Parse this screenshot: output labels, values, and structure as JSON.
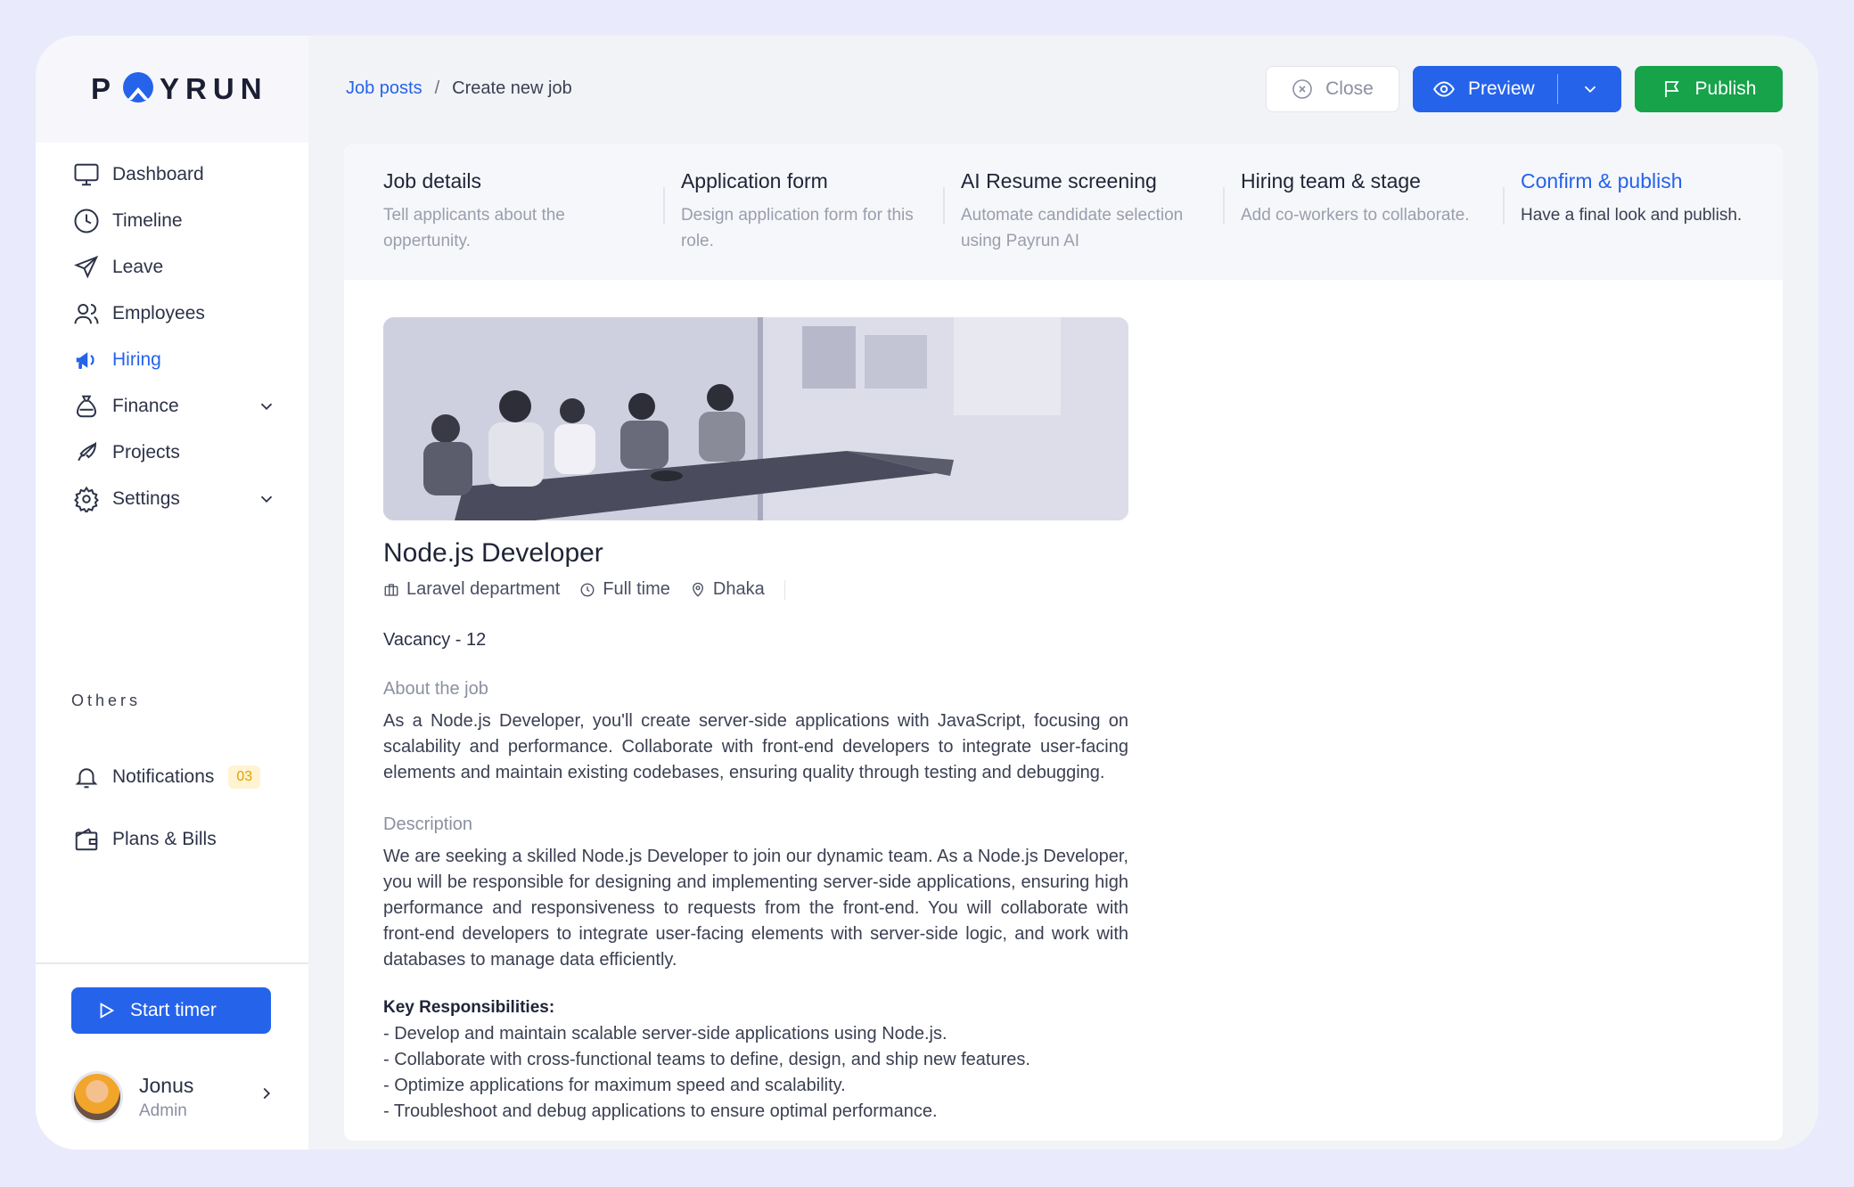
{
  "brand": {
    "logo_text_left": "P",
    "logo_text_right": "YRUN"
  },
  "sidebar": {
    "items": [
      {
        "label": "Dashboard"
      },
      {
        "label": "Timeline"
      },
      {
        "label": "Leave"
      },
      {
        "label": "Employees"
      },
      {
        "label": "Hiring"
      },
      {
        "label": "Finance"
      },
      {
        "label": "Projects"
      },
      {
        "label": "Settings"
      }
    ],
    "others_label": "Others",
    "others": [
      {
        "label": "Notifications",
        "badge": "03"
      },
      {
        "label": "Plans & Bills"
      }
    ],
    "timer_label": "Start timer",
    "user": {
      "name": "Jonus",
      "role": "Admin"
    }
  },
  "breadcrumb": {
    "parent": "Job posts",
    "separator": "/",
    "current": "Create new job"
  },
  "toolbar": {
    "close_label": "Close",
    "preview_label": "Preview",
    "publish_label": "Publish"
  },
  "steps": [
    {
      "title": "Job details",
      "desc": "Tell applicants about the oppertunity."
    },
    {
      "title": "Application form",
      "desc": "Design application form for this role."
    },
    {
      "title": "AI Resume screening",
      "desc": "Automate candidate selection using Payrun AI"
    },
    {
      "title": "Hiring team & stage",
      "desc": "Add co-workers to collaborate."
    },
    {
      "title": "Confirm & publish",
      "desc": "Have a final look and publish."
    }
  ],
  "job": {
    "title": "Node.js Developer",
    "department": "Laravel department",
    "type": "Full time",
    "location": "Dhaka",
    "vacancy": "Vacancy - 12",
    "about_label": "About the job",
    "about": "As a Node.js Developer, you'll create server-side applications with JavaScript, focusing on scalability and performance. Collaborate with front-end developers to integrate user-facing elements and maintain existing codebases, ensuring quality through testing and debugging.",
    "description_label": "Description",
    "description": "We are seeking a skilled Node.js Developer to join our dynamic team. As a Node.js Developer, you will be responsible for designing and implementing server-side applications, ensuring high performance and responsiveness to requests from the front-end. You will collaborate with front-end developers to integrate user-facing elements with server-side logic, and work with databases to manage data efficiently.",
    "responsibilities_label": "Key Responsibilities:",
    "responsibilities": [
      "- Develop and maintain scalable server-side applications using Node.js.",
      "- Collaborate with cross-functional teams to define, design, and ship new features.",
      "- Optimize applications for maximum speed and scalability.",
      "- Troubleshoot and debug applications to ensure optimal performance."
    ]
  },
  "colors": {
    "accent": "#2563eb",
    "publish": "#16a34a",
    "badge_bg": "#fff3d1",
    "badge_fg": "#e2a100"
  }
}
